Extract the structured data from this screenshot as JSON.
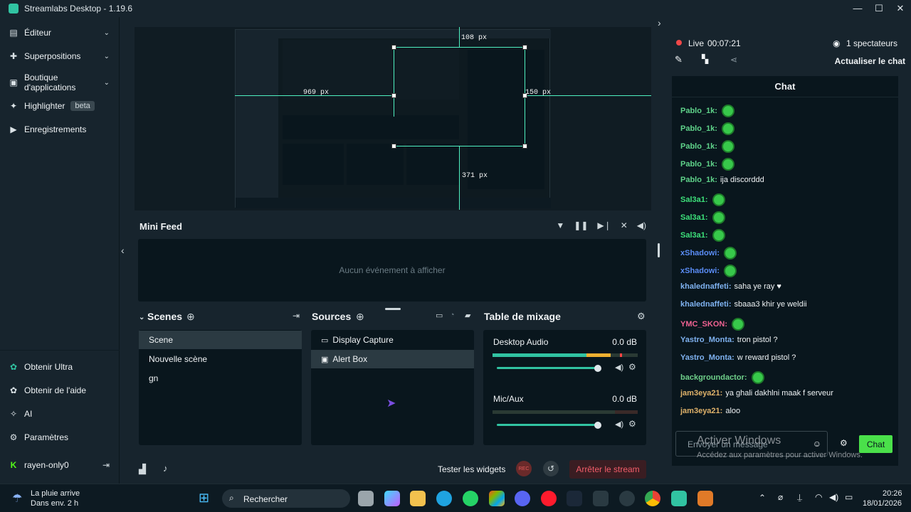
{
  "window": {
    "title": "Streamlabs Desktop - 1.19.6",
    "controls": [
      "—",
      "☐",
      "✕"
    ]
  },
  "sidebar": {
    "items": [
      {
        "label": "Éditeur",
        "icon": "layers-icon"
      },
      {
        "label": "Superpositions",
        "icon": "overlays-icon"
      },
      {
        "label": "Boutique d'applications",
        "icon": "store-icon"
      },
      {
        "label": "Highlighter",
        "icon": "highlighter-icon",
        "badge": "beta"
      },
      {
        "label": "Enregistrements",
        "icon": "recordings-icon"
      }
    ],
    "bottom": [
      {
        "label": "Obtenir Ultra",
        "icon": "ultra-icon"
      },
      {
        "label": "Obtenir de l'aide",
        "icon": "help-icon"
      },
      {
        "label": "AI",
        "icon": "ai-icon"
      },
      {
        "label": "Paramètres",
        "icon": "gear-icon"
      },
      {
        "label": "rayen-only0",
        "icon": "kick-icon"
      }
    ]
  },
  "preview": {
    "measure_top": "108  px",
    "measure_left": "969  px",
    "measure_right": "150  px",
    "measure_bottom": "371  px"
  },
  "minifeed": {
    "title": "Mini Feed",
    "empty": "Aucun événement à afficher"
  },
  "scenes": {
    "title": "Scenes",
    "items": [
      "Scene",
      "Nouvelle scène",
      "gn"
    ]
  },
  "sources": {
    "title": "Sources",
    "items": [
      "Display Capture",
      "Alert Box"
    ]
  },
  "mixer": {
    "title": "Table de mixage",
    "channels": [
      {
        "name": "Desktop Audio",
        "db": "0.0 dB"
      },
      {
        "name": "Mic/Aux",
        "db": "0.0 dB"
      }
    ]
  },
  "footer": {
    "test_widgets": "Tester les widgets",
    "rec": "REC",
    "stop_stream": "Arrêter le stream"
  },
  "stream": {
    "live": "Live",
    "time": "00:07:21",
    "viewers": "1 spectateurs",
    "refresh_chat": "Actualiser le chat"
  },
  "chat": {
    "title": "Chat",
    "messages": [
      {
        "user": "Pablo_1k:",
        "text": "",
        "emote": true,
        "color": "#5fd38a"
      },
      {
        "user": "Pablo_1k:",
        "text": "",
        "emote": true,
        "color": "#5fd38a"
      },
      {
        "user": "Pablo_1k:",
        "text": "",
        "emote": true,
        "color": "#5fd38a"
      },
      {
        "user": "Pablo_1k:",
        "text": "",
        "emote": true,
        "color": "#5fd38a"
      },
      {
        "user": "Pablo_1k:",
        "text": "ija discorddd",
        "emote": false,
        "color": "#5fd38a"
      },
      {
        "user": "Sal3a1:",
        "text": "",
        "emote": true,
        "color": "#3de07a"
      },
      {
        "user": "Sal3a1:",
        "text": "",
        "emote": true,
        "color": "#3de07a"
      },
      {
        "user": "Sal3a1:",
        "text": "",
        "emote": true,
        "color": "#3de07a"
      },
      {
        "user": "xShadowi:",
        "text": "",
        "emote": true,
        "color": "#5a8cf5"
      },
      {
        "user": "xShadowi:",
        "text": "",
        "emote": true,
        "color": "#5a8cf5"
      },
      {
        "user": "khalednaffeti:",
        "text": "saha ye ray ♥",
        "emote": false,
        "color": "#7fb2f0"
      },
      {
        "user": "khalednaffeti:",
        "text": "sbaaa3 khir ye weldii",
        "emote": false,
        "color": "#7fb2f0"
      },
      {
        "user": "YMC_SKON:",
        "text": "",
        "emote": true,
        "color": "#f06292"
      },
      {
        "user": "Yastro_Monta:",
        "text": "tron pistol ?",
        "emote": false,
        "color": "#7fb2f0"
      },
      {
        "user": "Yastro_Monta:",
        "text": "w reward pistol ?",
        "emote": false,
        "color": "#7fb2f0"
      },
      {
        "user": "backgroundactor:",
        "text": "",
        "emote": true,
        "color": "#6fd08a"
      },
      {
        "user": "jam3eya21:",
        "text": "ya ghali dakhlni maak f serveur",
        "emote": false,
        "color": "#e0b26a"
      },
      {
        "user": "jam3eya21:",
        "text": "aloo",
        "emote": false,
        "color": "#e0b26a"
      }
    ],
    "input_placeholder": "Envoyer un message",
    "send": "Chat",
    "watermark_title": "Activer Windows",
    "watermark_sub": "Accédez aux paramètres pour activer Windows."
  },
  "taskbar": {
    "weather_title": "La pluie arrive",
    "weather_sub": "Dans env. 2 h",
    "search": "Rechercher",
    "time": "20:26",
    "date": "18/01/2026"
  }
}
